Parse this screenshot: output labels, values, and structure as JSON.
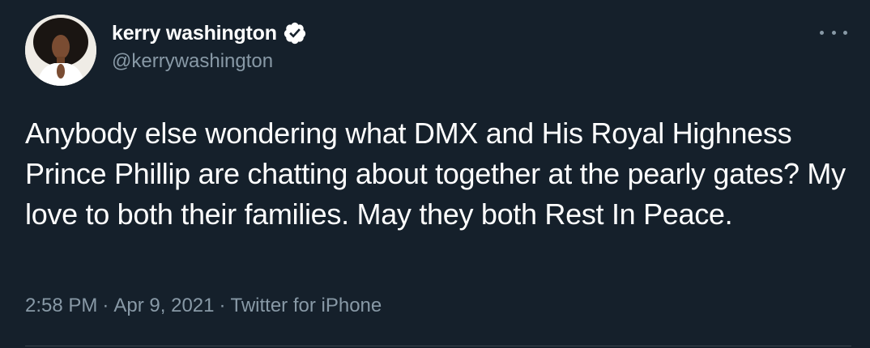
{
  "tweet": {
    "author": {
      "display_name": "kerry washington",
      "handle": "@kerrywashington",
      "verified": true,
      "avatar_icon": "profile-photo"
    },
    "more_icon": "ellipsis-icon",
    "text": "Anybody else wondering what DMX and His Royal Highness Prince Phillip are chatting about together at the pearly gates? My love to both their families. May they both Rest In Peace.",
    "time": "2:58 PM",
    "date": "Apr 9, 2021",
    "source": "Twitter for iPhone",
    "separator": "·"
  },
  "colors": {
    "background": "#15202b",
    "primary_text": "#ffffff",
    "secondary_text": "#8899a6",
    "divider": "#38444d"
  }
}
